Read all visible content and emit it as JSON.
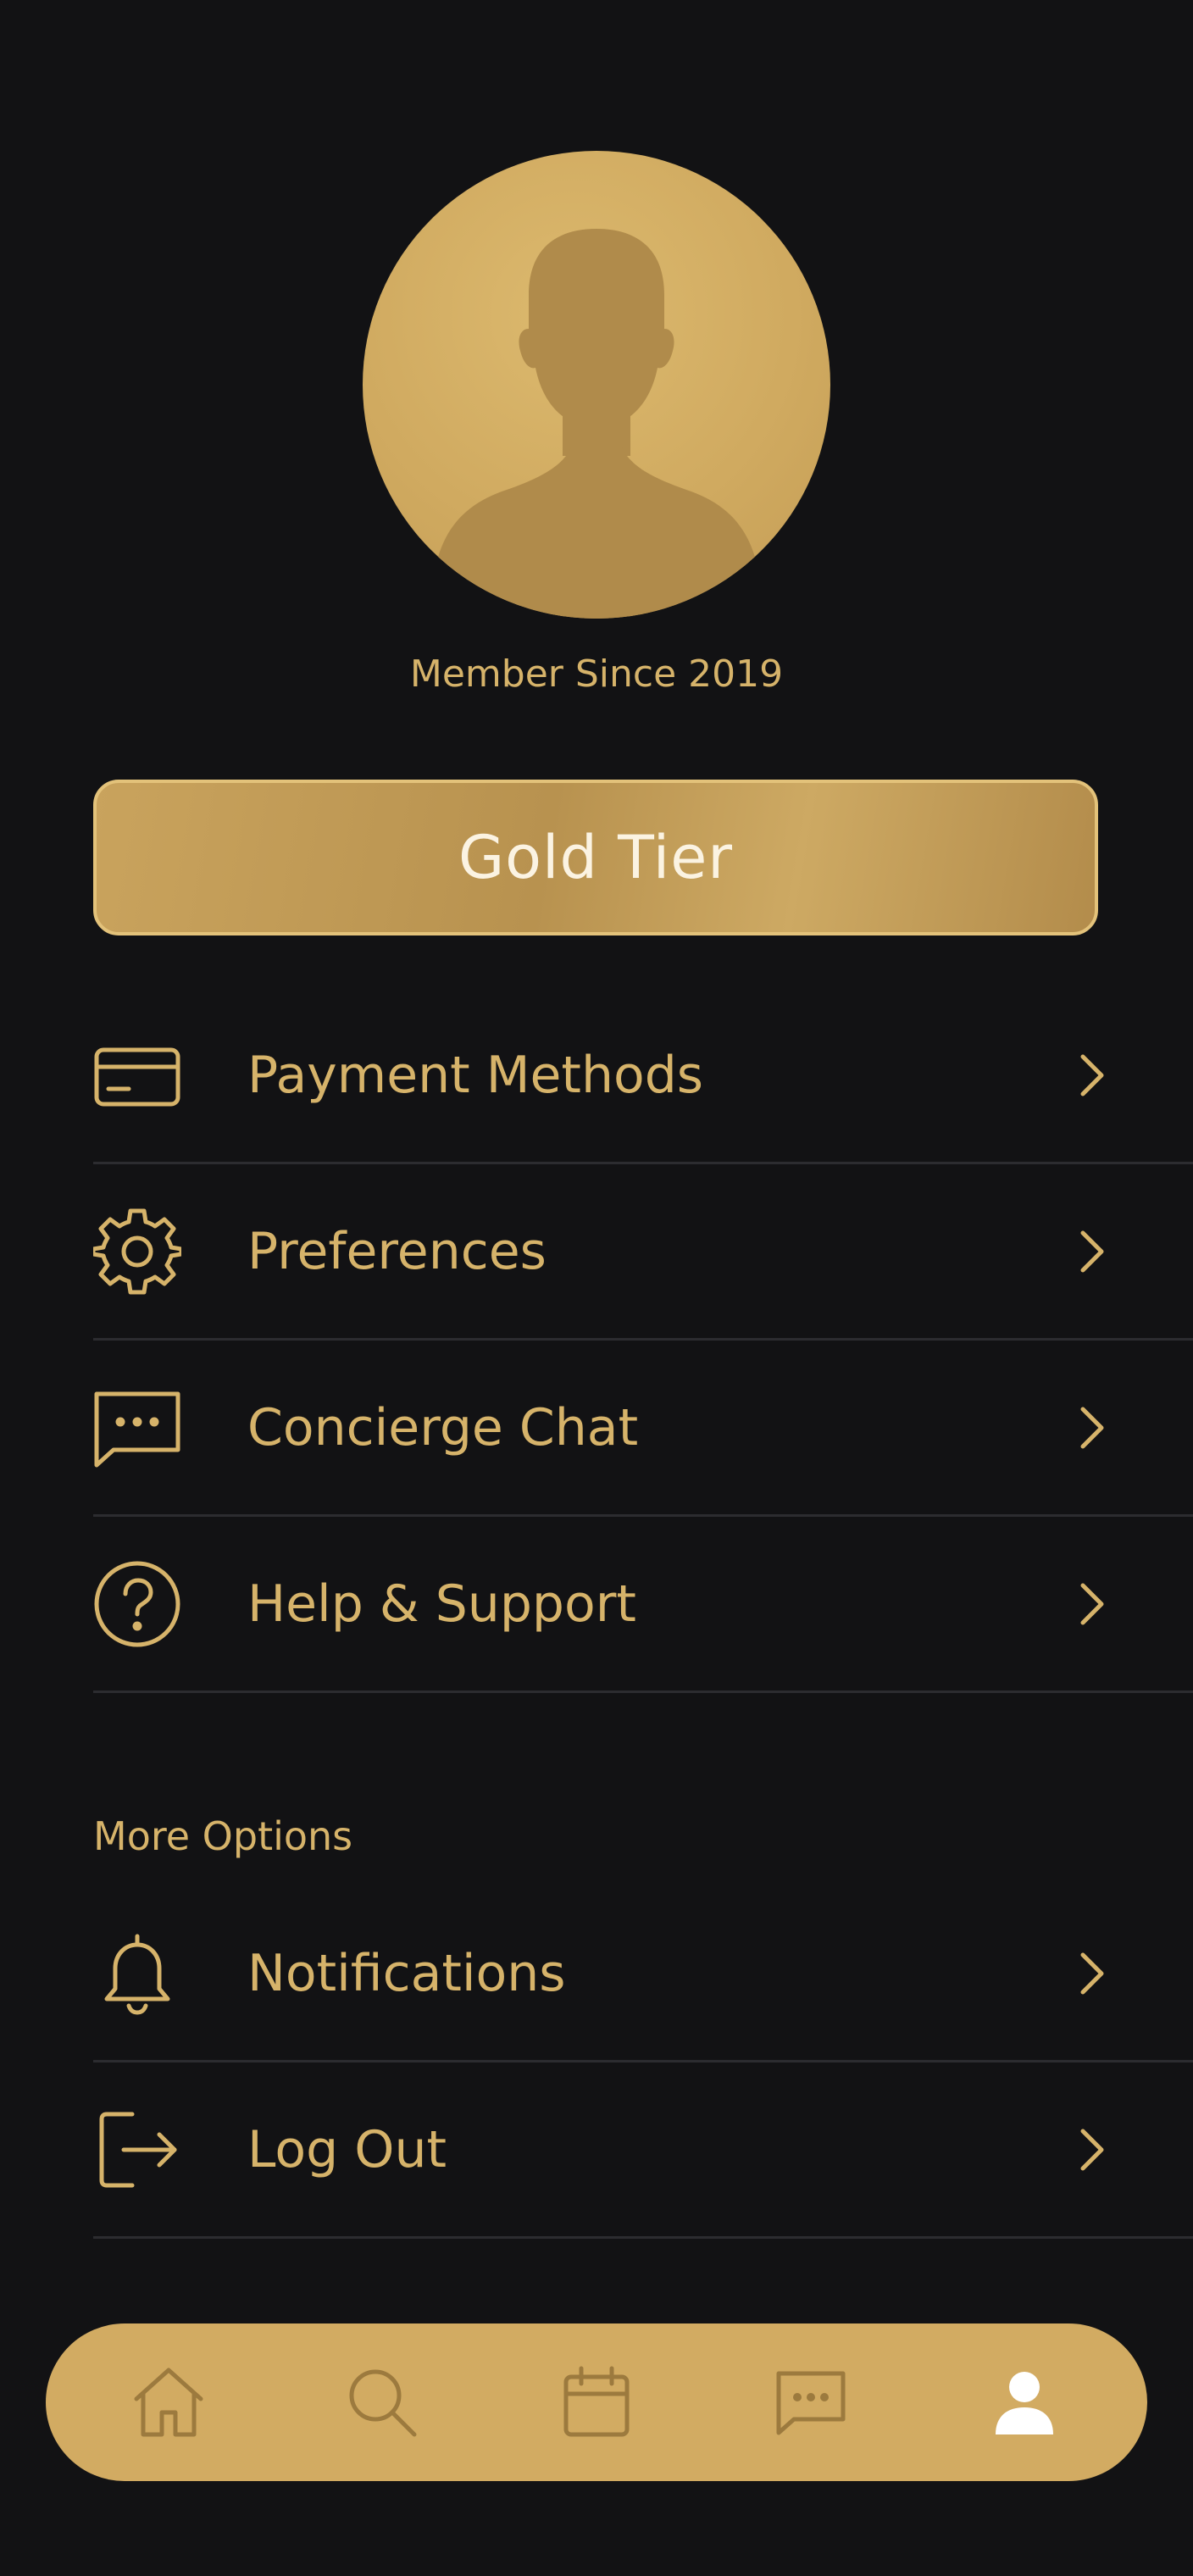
{
  "profile": {
    "member_since": "Member Since 2019",
    "tier_label": "Gold Tier"
  },
  "menu": {
    "items": [
      {
        "label": "Payment Methods",
        "icon": "credit-card-icon"
      },
      {
        "label": "Preferences",
        "icon": "gear-icon"
      },
      {
        "label": "Concierge Chat",
        "icon": "chat-bubble-icon"
      },
      {
        "label": "Help & Support",
        "icon": "question-circle-icon"
      }
    ]
  },
  "more_options": {
    "header": "More Options",
    "items": [
      {
        "label": "Notifications",
        "icon": "bell-icon"
      },
      {
        "label": "Log Out",
        "icon": "logout-icon"
      }
    ]
  },
  "bottom_nav": {
    "items": [
      {
        "icon": "home-icon",
        "active": false
      },
      {
        "icon": "search-icon",
        "active": false
      },
      {
        "icon": "calendar-icon",
        "active": false
      },
      {
        "icon": "chat-icon",
        "active": false
      },
      {
        "icon": "profile-icon",
        "active": true
      }
    ]
  },
  "colors": {
    "background": "#121214",
    "accent_gold": "#d6b36a",
    "nav_background": "#d2ab62",
    "nav_icon": "#9c7a3e",
    "nav_active_icon": "#ffffff",
    "divider": "#2c2c30"
  }
}
